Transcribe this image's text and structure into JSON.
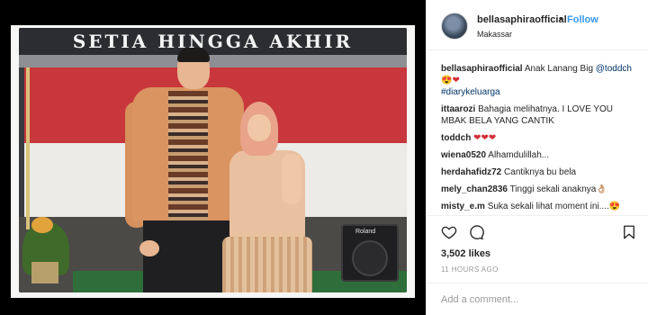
{
  "photo": {
    "banner_text": "SETIA HINGGA AKHIR",
    "speaker_brand": "Roland"
  },
  "header": {
    "username": "bellasaphiraofficial",
    "separator": "•",
    "follow_label": "Follow",
    "location": "Makassar",
    "accent_color": "#3897f0"
  },
  "caption": {
    "username": "bellasaphiraofficial",
    "text_pre": "Anak Lanang Big ",
    "mention": "@toddch",
    "emoji": "😍❤",
    "hashtag": "#diarykeluarga"
  },
  "comments": [
    {
      "username": "ittaarozi",
      "text": "Bahagia melihatnya. I LOVE YOU MBAK BELA YANG CANTIK"
    },
    {
      "username": "toddch",
      "text": "❤❤❤"
    },
    {
      "username": "wiena0520",
      "text": "Alhamdulillah..."
    },
    {
      "username": "herdahafidz72",
      "text": "Cantiknya bu bela"
    },
    {
      "username": "mely_chan2836",
      "text": "Tinggi sekali anaknya👌🏼"
    },
    {
      "username": "misty_e.m",
      "text": "Suka sekali lihat moment ini....😍"
    }
  ],
  "actions": {
    "like_icon": "heart-outline-icon",
    "comment_icon": "speech-bubble-icon",
    "save_icon": "bookmark-icon"
  },
  "likes_text": "3,502 likes",
  "time_ago": "11 HOURS AGO",
  "add_comment": {
    "placeholder": "Add a comment..."
  }
}
